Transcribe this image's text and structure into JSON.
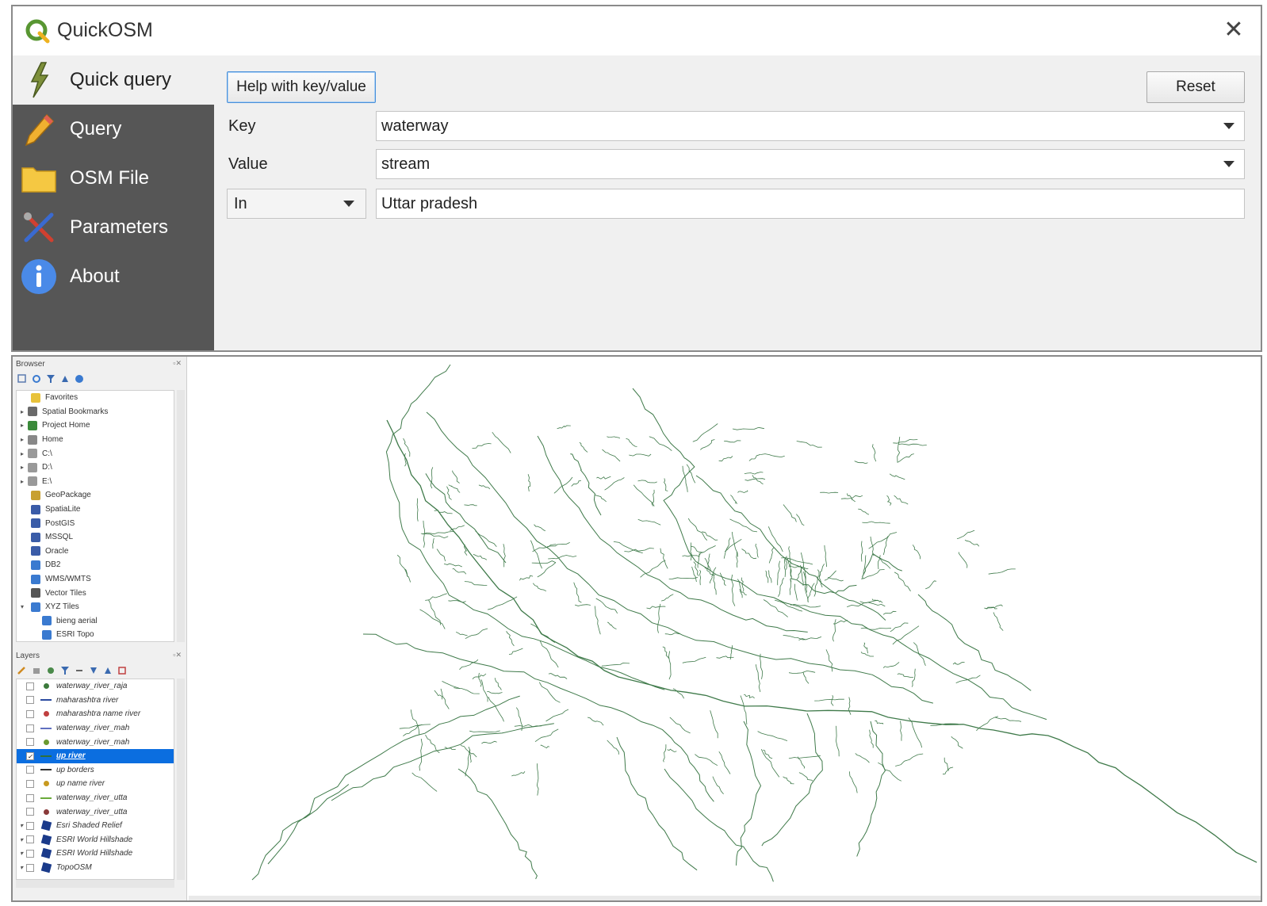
{
  "dialog": {
    "title": "QuickOSM",
    "close_glyph": "✕",
    "sidebar": [
      {
        "label": "Quick query",
        "icon": "lightning-icon",
        "active": true
      },
      {
        "label": "Query",
        "icon": "pencil-icon",
        "active": false
      },
      {
        "label": "OSM File",
        "icon": "folder-icon",
        "active": false
      },
      {
        "label": "Parameters",
        "icon": "tools-icon",
        "active": false
      },
      {
        "label": "About",
        "icon": "info-icon",
        "active": false
      }
    ],
    "help_button": "Help with key/value",
    "reset_button": "Reset",
    "key_label": "Key",
    "key_value": "waterway",
    "value_label": "Value",
    "value_value": "stream",
    "in_select": "In",
    "place_value": "Uttar pradesh"
  },
  "qgis": {
    "browser": {
      "title": "Browser",
      "items": [
        {
          "label": "Favorites",
          "icon": "star-icon",
          "color": "#e8c23a"
        },
        {
          "label": "Spatial Bookmarks",
          "icon": "bookmark-icon",
          "color": "#6a6a6a"
        },
        {
          "label": "Project Home",
          "icon": "project-home-icon",
          "color": "#3b8a3b"
        },
        {
          "label": "Home",
          "icon": "home-folder-icon",
          "color": "#888888"
        },
        {
          "label": "C:\\",
          "icon": "drive-icon",
          "color": "#999999"
        },
        {
          "label": "D:\\",
          "icon": "drive-icon",
          "color": "#999999"
        },
        {
          "label": "E:\\",
          "icon": "drive-icon",
          "color": "#999999"
        },
        {
          "label": "GeoPackage",
          "icon": "geopackage-icon",
          "color": "#c8a030"
        },
        {
          "label": "SpatiaLite",
          "icon": "spatialite-icon",
          "color": "#3a5ca8"
        },
        {
          "label": "PostGIS",
          "icon": "postgis-icon",
          "color": "#3a5ca8"
        },
        {
          "label": "MSSQL",
          "icon": "mssql-icon",
          "color": "#3a5ca8"
        },
        {
          "label": "Oracle",
          "icon": "oracle-icon",
          "color": "#3a5ca8"
        },
        {
          "label": "DB2",
          "icon": "db2-icon",
          "color": "#3a7ad0"
        },
        {
          "label": "WMS/WMTS",
          "icon": "wms-icon",
          "color": "#3a7ad0"
        },
        {
          "label": "Vector Tiles",
          "icon": "vector-tiles-icon",
          "color": "#555555"
        },
        {
          "label": "XYZ Tiles",
          "icon": "xyz-tiles-icon",
          "color": "#3a7ad0"
        },
        {
          "label": "bieng aerial",
          "icon": "xyz-tiles-icon",
          "color": "#3a7ad0"
        },
        {
          "label": "ESRI Topo",
          "icon": "xyz-tiles-icon",
          "color": "#3a7ad0"
        }
      ]
    },
    "layers": {
      "title": "Layers",
      "items": [
        {
          "label": "waterway_river_raja",
          "checked": false,
          "selected": false,
          "sym": "point",
          "color": "#3b7a3b"
        },
        {
          "label": "maharashtra river",
          "checked": false,
          "selected": false,
          "sym": "line",
          "color": "#2a4aa0"
        },
        {
          "label": "maharashtra name river",
          "checked": false,
          "selected": false,
          "sym": "point",
          "color": "#c04040"
        },
        {
          "label": "waterway_river_mah",
          "checked": false,
          "selected": false,
          "sym": "line",
          "color": "#6070c0"
        },
        {
          "label": "waterway_river_mah",
          "checked": false,
          "selected": false,
          "sym": "point",
          "color": "#6a9a30"
        },
        {
          "label": "up river",
          "checked": true,
          "selected": true,
          "sym": "line",
          "color": "#2f6f3a"
        },
        {
          "label": "up borders",
          "checked": false,
          "selected": false,
          "sym": "line",
          "color": "#333333"
        },
        {
          "label": "up name river",
          "checked": false,
          "selected": false,
          "sym": "point",
          "color": "#c89a20"
        },
        {
          "label": "waterway_river_utta",
          "checked": false,
          "selected": false,
          "sym": "line",
          "color": "#6aaa3a"
        },
        {
          "label": "waterway_river_utta",
          "checked": false,
          "selected": false,
          "sym": "point",
          "color": "#8a3a3a"
        },
        {
          "label": "Esri Shaded Relief",
          "checked": false,
          "selected": false,
          "sym": "raster",
          "color": "#1a3a8a"
        },
        {
          "label": "ESRI World Hillshade",
          "checked": false,
          "selected": false,
          "sym": "raster",
          "color": "#1a3a8a"
        },
        {
          "label": "ESRI World Hillshade",
          "checked": false,
          "selected": false,
          "sym": "raster",
          "color": "#1a3a8a"
        },
        {
          "label": "TopoOSM",
          "checked": false,
          "selected": false,
          "sym": "raster",
          "color": "#1a3a8a"
        }
      ]
    },
    "river_color": "#3f7a4a",
    "selection_color": "#0b6ee0"
  }
}
